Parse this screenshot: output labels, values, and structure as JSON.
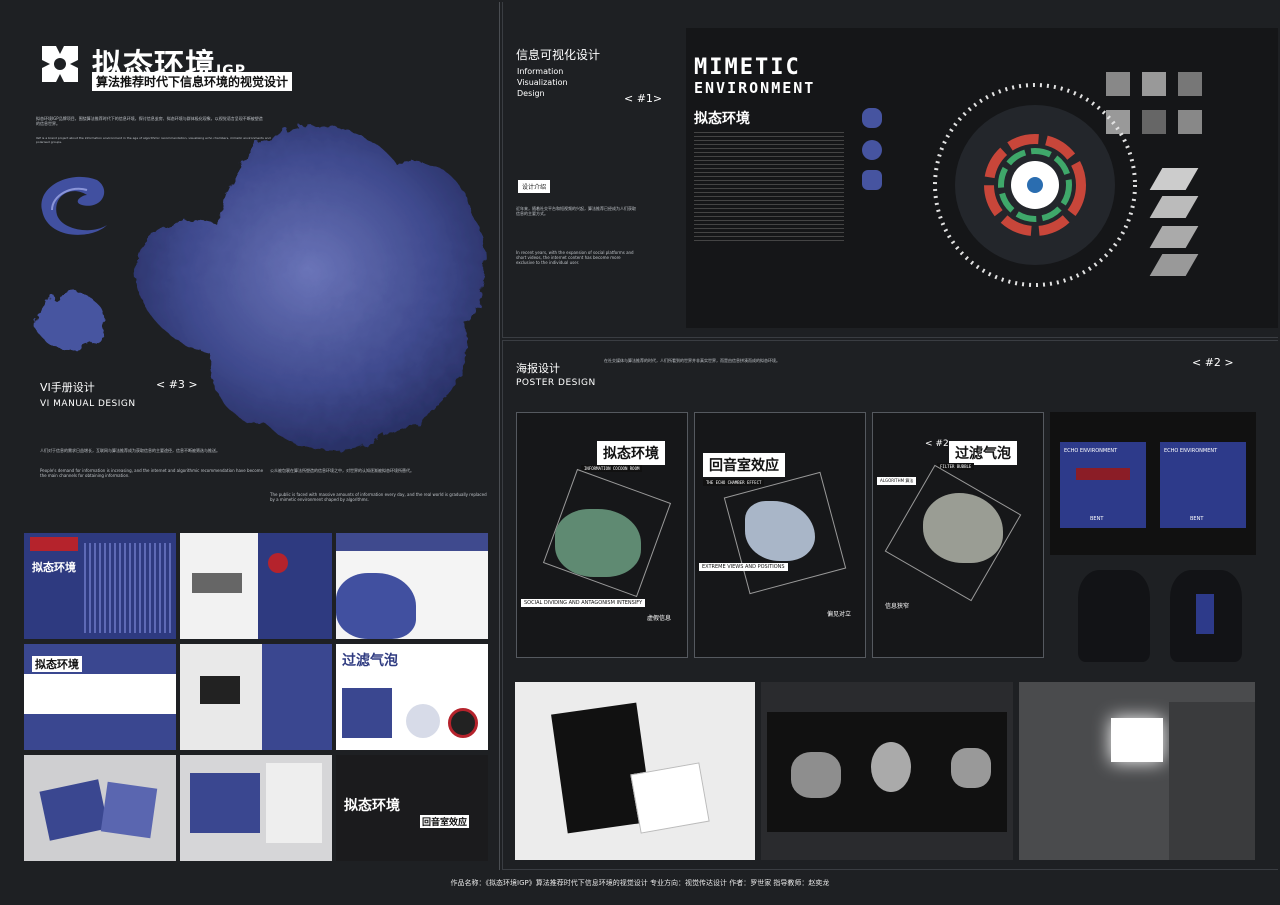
{
  "brand": {
    "title": "拟态环境",
    "suffix": "IGP",
    "subtitle": "算法推荐时代下信息环境的视觉设计"
  },
  "left": {
    "intro_cn": "拟态环境IGP品牌项目，围绕算法推荐时代下的信息环境，探讨信息茧房、拟态环境与群体极化现象，以视觉语言呈现不断被塑造的信息世界。",
    "intro_en": "IGP is a brand project about the information environment in the age of algorithmic recommendation, visualising echo chambers, mimetic environments and polarised groups.",
    "section_cn": "VI手册设计",
    "section_en": "VI MANUAL DESIGN",
    "section_tag": "< #3 >",
    "body_cn_1": "人们对于信息的需求日益增长，互联网与算法推荐成为获取信息的主要途径，信息不断被筛选与推送。",
    "body_en_1": "People's demand for information is increasing, and the internet and algorithmic recommendation have become the main channels for obtaining information.",
    "body_cn_2": "公众被包裹在算法所塑造的信息环境之中，对世界的认知逐渐被拟态环境所替代。",
    "body_en_2": "The public is faced with massive amounts of information every day, and the real world is gradually replaced by a mimetic environment shaped by algorithms."
  },
  "info": {
    "title_cn": "信息可视化设计",
    "title_en_1": "Information",
    "title_en_2": "Visualization",
    "title_en_3": "Design",
    "tag": "< #1>",
    "button": "设计介绍",
    "desc_cn": "近年来，随着社交平台和短视频的兴起，算法推荐已经成为人们获取信息的主要方式。",
    "desc_en": "In recent years, with the expansion of social platforms and short videos, the internet content has become more exclusive to the individual user.",
    "big_title_1": "MIMETIC",
    "big_title_2": "ENVIRONMENT",
    "sub_brand": "拟态环境"
  },
  "poster": {
    "title_cn": "海报设计",
    "title_en": "POSTER DESIGN",
    "tag": "< #2 >",
    "desc": "在社交媒体与算法推荐的时代，人们所看到的世界并非真实世界，而是由信息拼凑而成的拟态环境。",
    "cards": [
      {
        "title": "拟态环境",
        "sub": "INFORMATION COCOON ROOM",
        "cap1": "SOCIAL DIVIDING AND ANTAGONISM INTENSIFY",
        "cap2": "虚假信息"
      },
      {
        "title": "回音室效应",
        "sub": "THE ECHO CHAMBER EFFECT",
        "cap1": "EXTREME VIEWS AND POSITIONS",
        "cap2": "偏见对立"
      },
      {
        "title": "过滤气泡",
        "sub": "FILTER BUBBLE",
        "cap1": "ALGORITHM 算法",
        "cap2": "信息狭窄",
        "tag": "< #2"
      }
    ],
    "panel_text_1": "ECHO ENVIRONMENT",
    "panel_text_2": "BENT"
  },
  "thumbs": {
    "t1": "拟态环境",
    "t2": "拟态环境",
    "t3": "过滤气泡",
    "t4": "回音室效应"
  },
  "footer": {
    "text": "作品名称：《拟态环境IGP》算法推荐时代下信息环境的视觉设计    专业方向：视觉传达设计    作者：罗世家    指导教师：赵奕龙"
  },
  "colors": {
    "bg": "#1e2023",
    "accent_blue": "#3f4d96",
    "accent_red": "#b5232c",
    "white": "#ffffff"
  }
}
